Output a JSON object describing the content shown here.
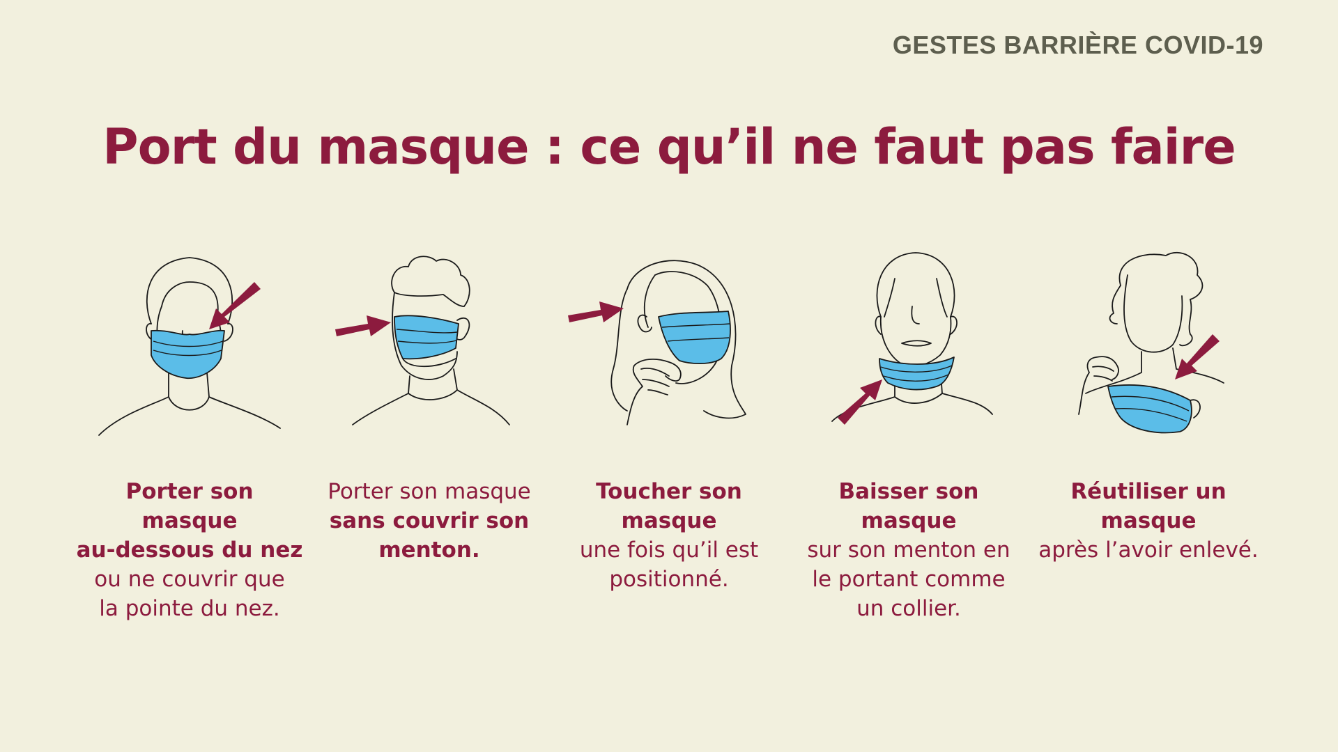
{
  "header_label": "GESTES BARRIÈRE COVID-19",
  "title": "Port du masque : ce qu’il ne faut pas faire",
  "colors": {
    "background": "#f2f0de",
    "accent": "#8c1b3e",
    "mask": "#5bbde8",
    "header": "#5d5e4e"
  },
  "items": [
    {
      "illustration": "face-mask-under-nose-illustration",
      "lines": [
        {
          "text": "Porter son",
          "bold": true
        },
        {
          "text": "masque",
          "bold": true
        },
        {
          "text": "au-dessous du nez",
          "bold": true
        },
        {
          "text": "ou ne couvrir que",
          "bold": false
        },
        {
          "text": "la pointe du nez.",
          "bold": false
        }
      ]
    },
    {
      "illustration": "face-mask-chin-uncovered-illustration",
      "lines": [
        {
          "text": "Porter son masque",
          "bold": false
        },
        {
          "text": "sans couvrir son",
          "bold": true
        },
        {
          "text": "menton.",
          "bold": true
        }
      ]
    },
    {
      "illustration": "face-touching-mask-illustration",
      "lines": [
        {
          "text": "Toucher son",
          "bold": true
        },
        {
          "text": "masque",
          "bold": true
        },
        {
          "text": "une fois qu’il est",
          "bold": false
        },
        {
          "text": "positionné.",
          "bold": false
        }
      ]
    },
    {
      "illustration": "face-mask-on-chin-illustration",
      "lines": [
        {
          "text": "Baisser son",
          "bold": true
        },
        {
          "text": "masque",
          "bold": true
        },
        {
          "text": "sur son menton en",
          "bold": false
        },
        {
          "text": "le portant comme",
          "bold": false
        },
        {
          "text": "un collier.",
          "bold": false
        }
      ]
    },
    {
      "illustration": "face-reusing-mask-illustration",
      "lines": [
        {
          "text": "Réutiliser un",
          "bold": true
        },
        {
          "text": "masque",
          "bold": true
        },
        {
          "text": "après l’avoir enlevé.",
          "bold": false
        }
      ]
    }
  ]
}
